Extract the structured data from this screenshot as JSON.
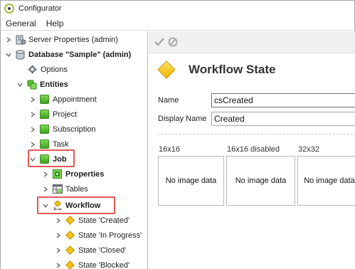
{
  "window": {
    "title": "Configurator"
  },
  "menu": {
    "items": [
      "General",
      "Help"
    ]
  },
  "tree": {
    "server_properties": "Server Properties (admin)",
    "database": "Database \"Sample\" (admin)",
    "options": "Options",
    "entities": "Entities",
    "appointment": "Appointment",
    "project": "Project",
    "subscription": "Subscription",
    "task": "Task",
    "job": "Job",
    "properties": "Properties",
    "tables": "Tables",
    "workflow": "Workflow",
    "states": [
      "State 'Created'",
      "State 'In Progress'",
      "State 'Closed'",
      "State 'Blocked'"
    ]
  },
  "detail": {
    "title": "Workflow State",
    "name_label": "Name",
    "name_value": "csCreated",
    "display_name_label": "Display Name",
    "display_name_value": "Created",
    "image_labels": [
      "16x16",
      "16x16 disabled",
      "32x32"
    ],
    "no_image_text": "No image data"
  },
  "colors": {
    "highlight": "#e05858",
    "entity_green": "#4caf2a",
    "state_yellow": "#f3c21a"
  }
}
